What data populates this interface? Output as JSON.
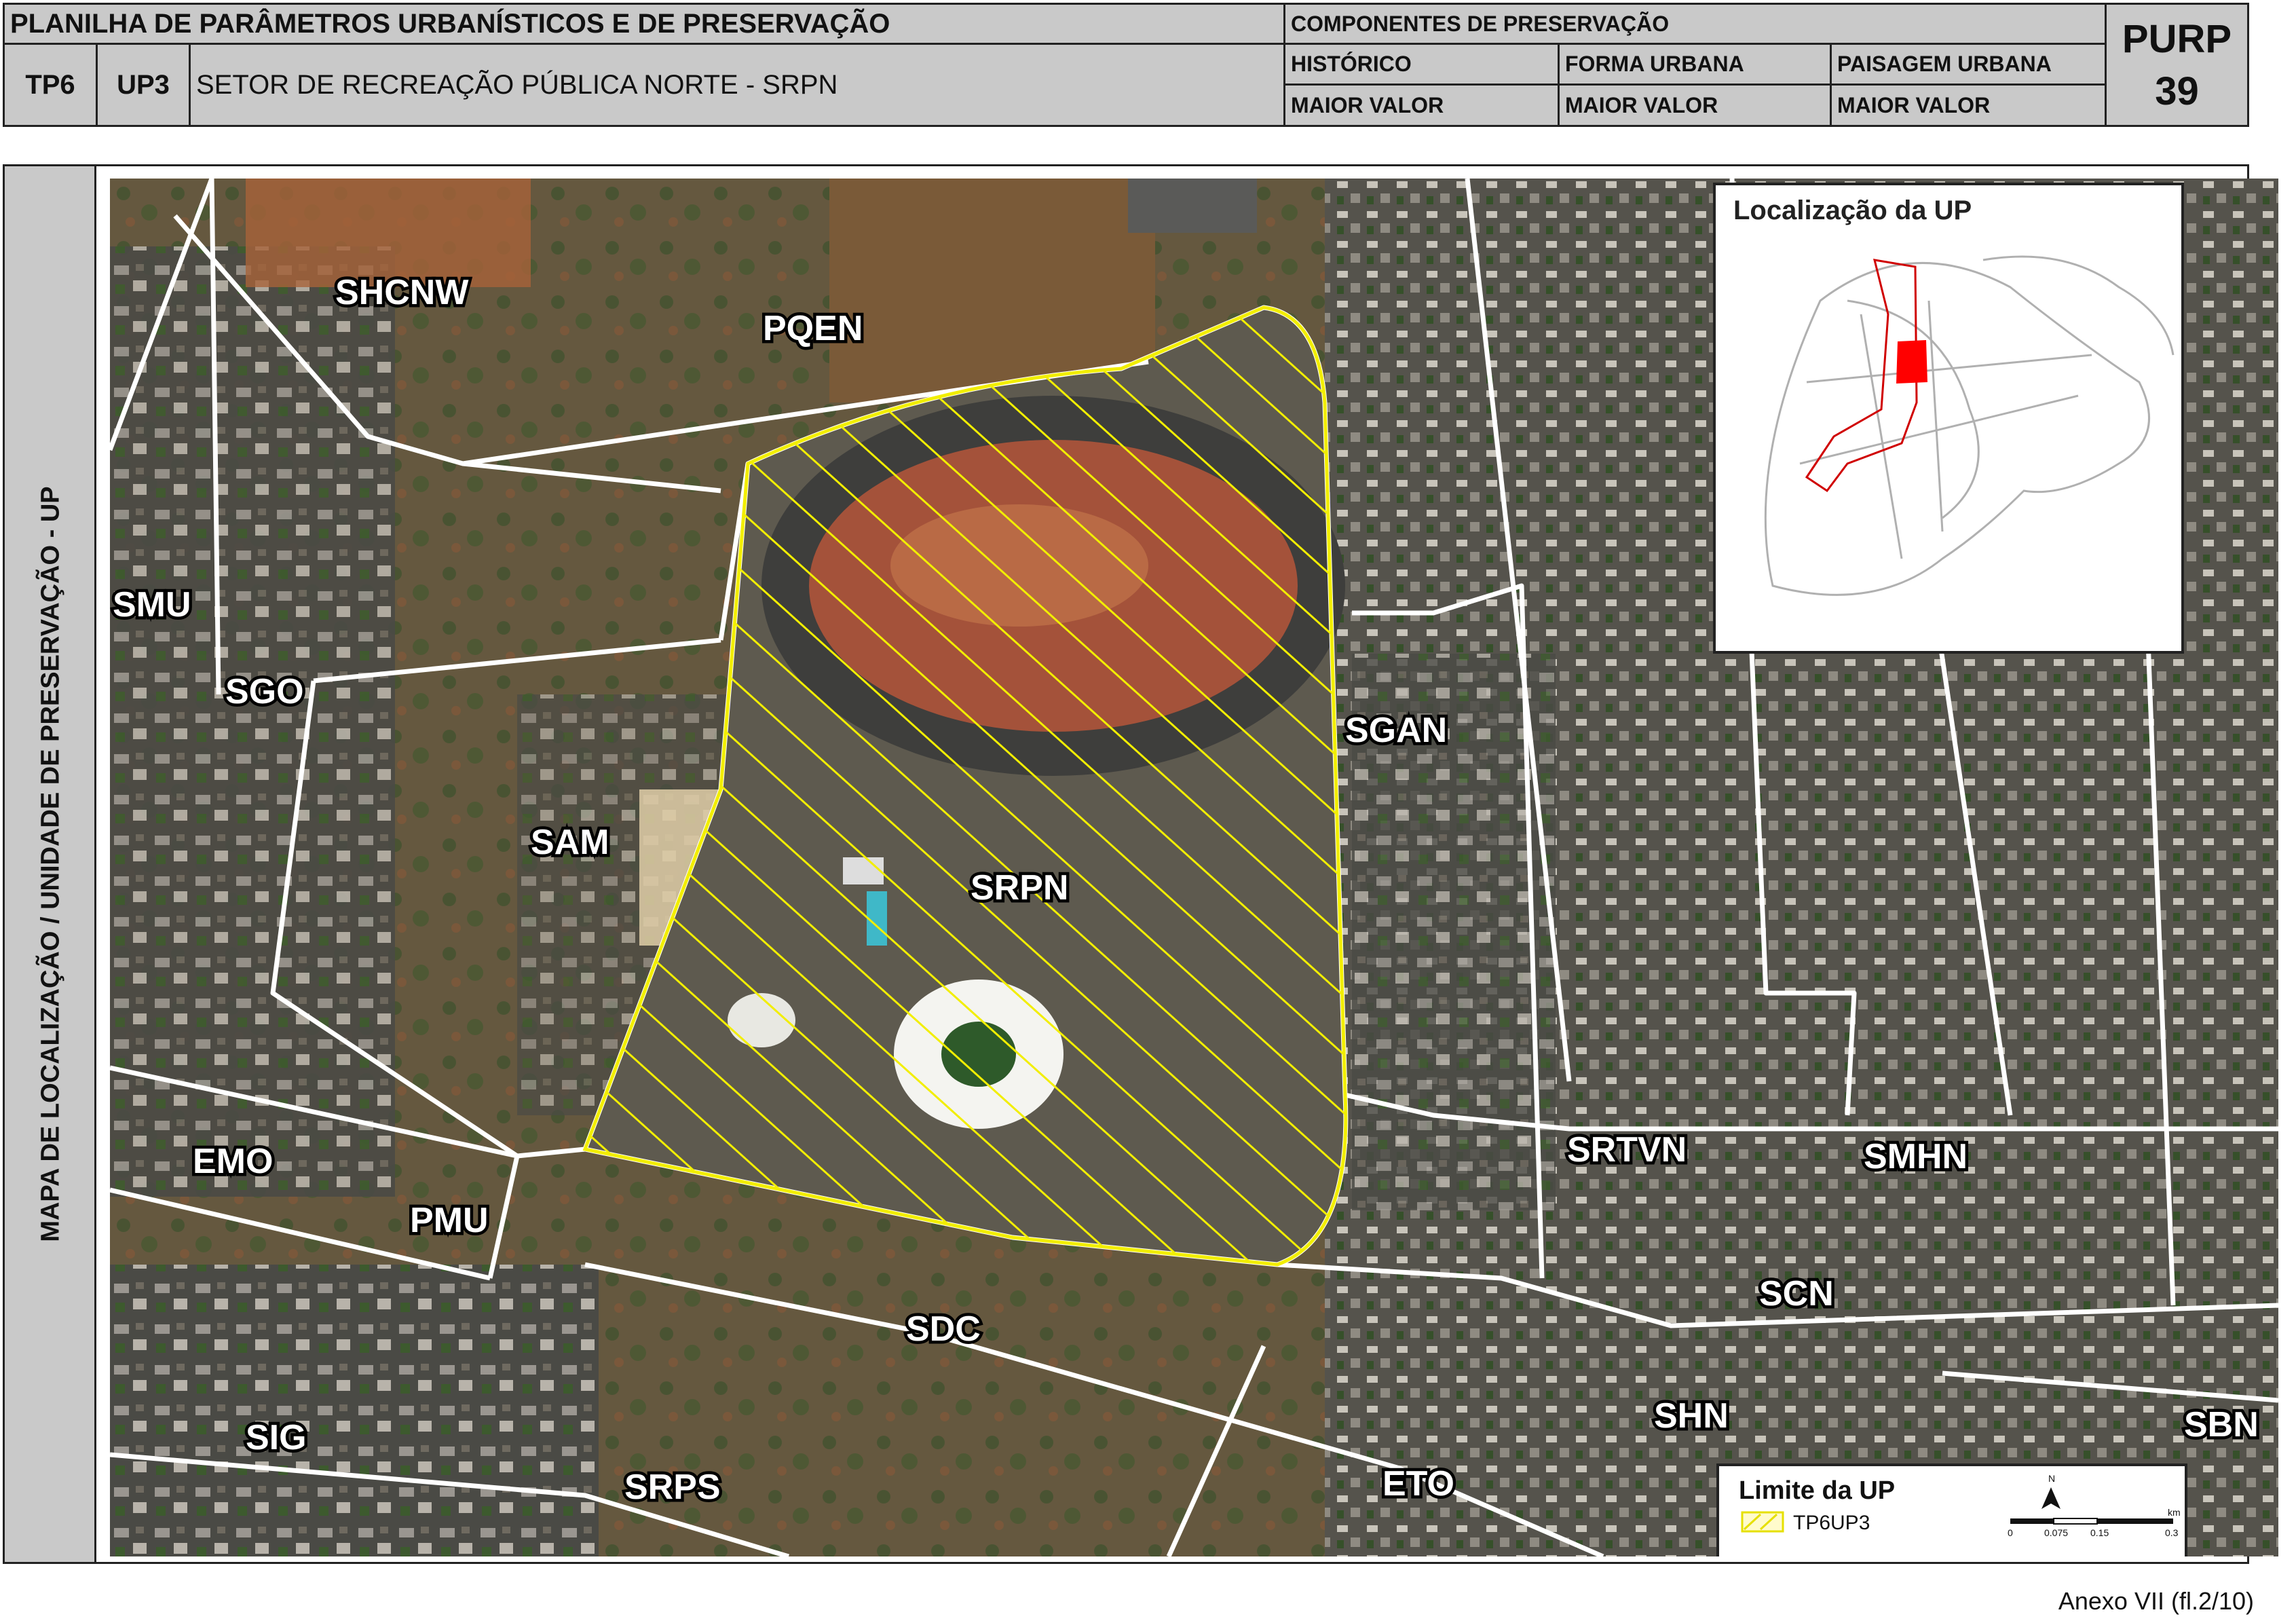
{
  "header": {
    "sheet_title": "PLANILHA DE PARÂMETROS URBANÍSTICOS E DE PRESERVAÇÃO",
    "tp": "TP6",
    "up": "UP3",
    "sector": "SETOR DE RECREAÇÃO PÚBLICA NORTE - SRPN",
    "components_title": "COMPONENTES DE PRESERVAÇÃO",
    "components": [
      {
        "name": "HISTÓRICO",
        "value": "MAIOR VALOR"
      },
      {
        "name": "FORMA URBANA",
        "value": "MAIOR VALOR"
      },
      {
        "name": "PAISAGEM URBANA",
        "value": "MAIOR VALOR"
      }
    ],
    "purp_label": "PURP",
    "purp_number": "39"
  },
  "sidebar": {
    "label": "MAPA DE LOCALIZAÇÃO / UNIDADE DE PRESERVAÇÃO - UP"
  },
  "map": {
    "areas": [
      "SHCNW",
      "PQEN",
      "SMU",
      "SGO",
      "SAM",
      "SGAN",
      "SRPN",
      "EMO",
      "PMU",
      "SRTVN",
      "SMHN",
      "SCN",
      "SDC",
      "SHN",
      "SIG",
      "SRPS",
      "ETO",
      "SBN"
    ],
    "highlight_area": "SRPN",
    "hatch_color": "#f5f000",
    "boundary_color": "#ffffff"
  },
  "inset": {
    "title": "Localização da UP",
    "highlight_color": "#ff0000"
  },
  "legend": {
    "title": "Limite da UP",
    "item": "TP6UP3",
    "scale_labels": [
      "0",
      "0.075",
      "0.15",
      "0.3"
    ],
    "scale_unit": "km",
    "north_label": "N"
  },
  "footer": {
    "annex": "Anexo VII (fl.2/10)"
  }
}
